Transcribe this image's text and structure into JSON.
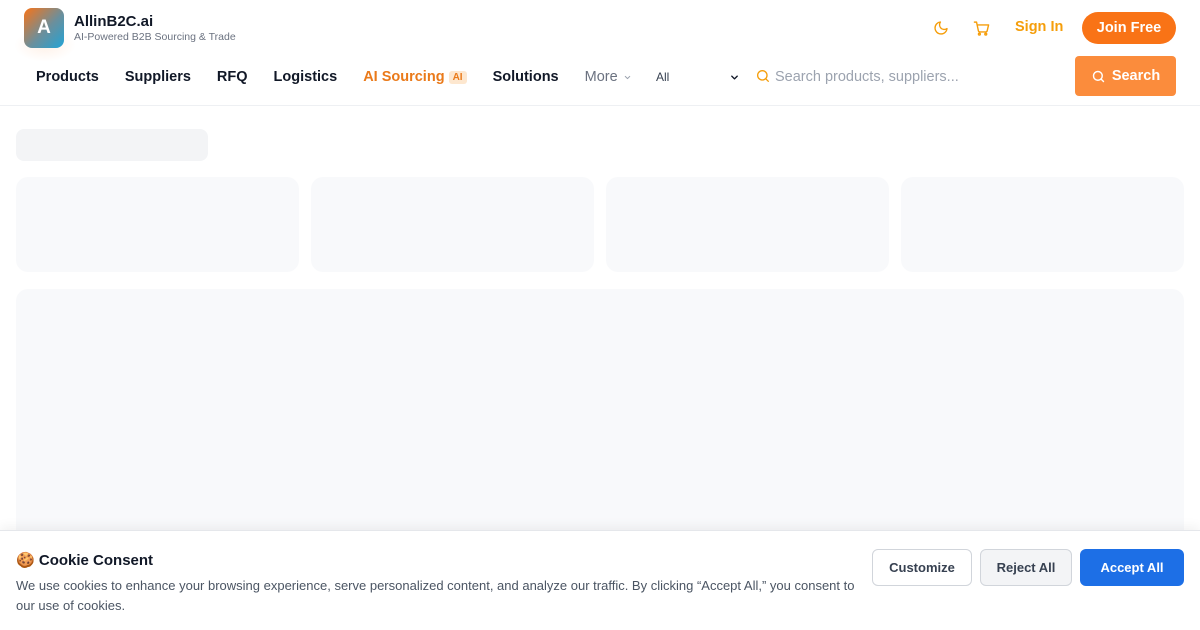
{
  "brand": {
    "logo_letter": "A",
    "name": "AllinB2C.ai",
    "tagline": "AI-Powered B2B Sourcing & Trade"
  },
  "header": {
    "theme_icon": "moon-icon",
    "cart_icon": "cart-icon",
    "signin_label": "Sign In",
    "join_label": "Join Free"
  },
  "nav": {
    "items": [
      {
        "label": "Products"
      },
      {
        "label": "Suppliers"
      },
      {
        "label": "RFQ"
      },
      {
        "label": "Logistics"
      },
      {
        "label": "AI Sourcing",
        "badge": "AI"
      },
      {
        "label": "Solutions"
      },
      {
        "label": "More"
      }
    ]
  },
  "search": {
    "category_selected": "All",
    "placeholder": "Search products, suppliers...",
    "button_label": "Search"
  },
  "cookie": {
    "emoji": "🍪",
    "title": "Cookie Consent",
    "text": "We use cookies to enhance your browsing experience, serve personalized content, and analyze our traffic. By clicking “Accept All,” you consent to our use of cookies.",
    "customize_label": "Customize",
    "reject_label": "Reject All",
    "accept_label": "Accept All"
  },
  "colors": {
    "accent": "#f97316",
    "signin": "#f59e0b",
    "accept": "#1d6fe6"
  }
}
